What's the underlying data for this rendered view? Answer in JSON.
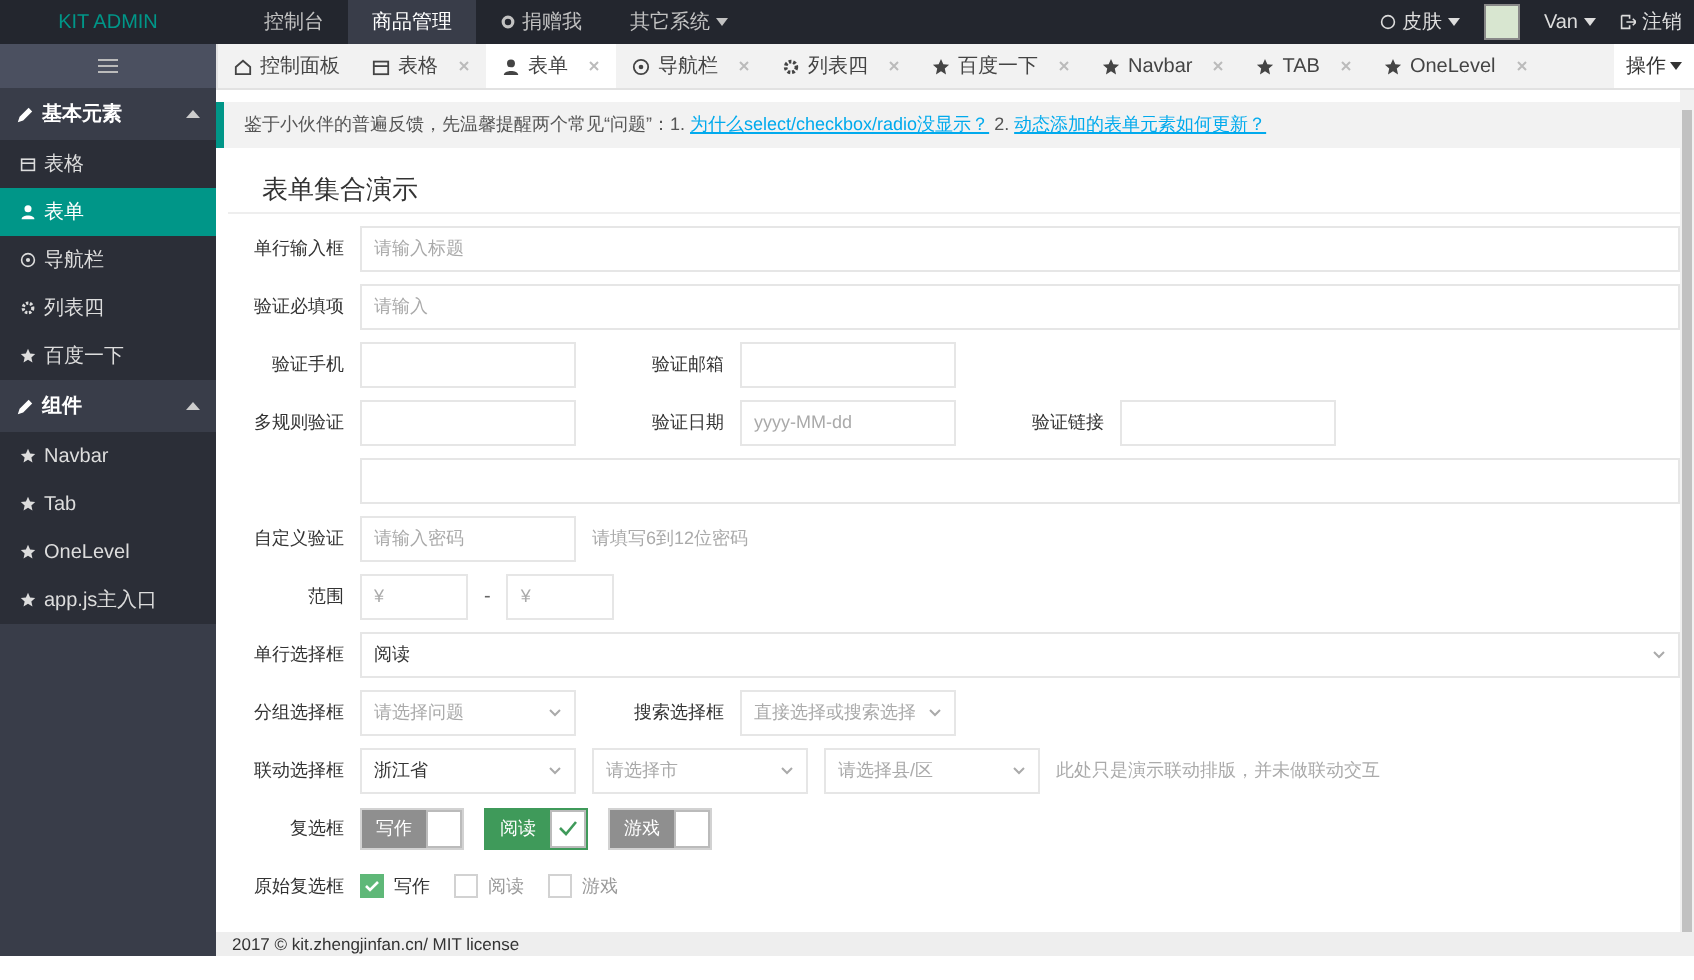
{
  "header": {
    "logo": "KIT ADMIN",
    "nav": [
      {
        "label": "控制台",
        "selected": false,
        "kind": "plain"
      },
      {
        "label": "商品管理",
        "selected": true,
        "kind": "plain"
      },
      {
        "label": "捐赠我",
        "selected": false,
        "kind": "icon"
      },
      {
        "label": "其它系统",
        "selected": false,
        "kind": "dropdown"
      }
    ],
    "skin": "皮肤",
    "user": "Van",
    "logout": "注销"
  },
  "sidebar": {
    "groups": [
      {
        "title": "基本元素",
        "expanded": true,
        "items": [
          {
            "label": "表格",
            "selected": false
          },
          {
            "label": "表单",
            "selected": true
          },
          {
            "label": "导航栏",
            "selected": false
          },
          {
            "label": "列表四",
            "selected": false
          },
          {
            "label": "百度一下",
            "selected": false
          }
        ]
      },
      {
        "title": "组件",
        "expanded": true,
        "items": [
          {
            "label": "Navbar",
            "selected": false
          },
          {
            "label": "Tab",
            "selected": false
          },
          {
            "label": "OneLevel",
            "selected": false
          },
          {
            "label": "app.js主入口",
            "selected": false
          }
        ]
      }
    ]
  },
  "tabs": [
    {
      "label": "控制面板",
      "selected": false,
      "closable": false
    },
    {
      "label": "表格",
      "selected": false,
      "closable": true
    },
    {
      "label": "表单",
      "selected": true,
      "closable": true
    },
    {
      "label": "导航栏",
      "selected": false,
      "closable": true
    },
    {
      "label": "列表四",
      "selected": false,
      "closable": true
    },
    {
      "label": "百度一下",
      "selected": false,
      "closable": true
    },
    {
      "label": "Navbar",
      "selected": false,
      "closable": true
    },
    {
      "label": "TAB",
      "selected": false,
      "closable": true
    },
    {
      "label": "OneLevel",
      "selected": false,
      "closable": true
    }
  ],
  "tab_actions": "操作",
  "notice_parts": [
    {
      "text": "鉴于小伙伴的普遍反馈，先温馨提醒两个常见“问题”：1. ",
      "kind": "text"
    },
    {
      "text": "为什么select/checkbox/radio没显示？",
      "kind": "link"
    },
    {
      "text": " 2. ",
      "kind": "text"
    },
    {
      "text": "动态添加的表单元素如何更新？",
      "kind": "link"
    }
  ],
  "form_title": "表单集合演示",
  "rows": [
    {
      "kind": "block",
      "label": "单行输入框",
      "field": {
        "kind": "input",
        "placeholder": "请输入标题"
      }
    },
    {
      "kind": "block",
      "label": "验证必填项",
      "field": {
        "kind": "input",
        "placeholder": "请输入"
      }
    },
    {
      "kind": "inline",
      "items": [
        {
          "label": "验证手机",
          "field": {
            "kind": "input"
          }
        },
        {
          "label": "验证邮箱",
          "field": {
            "kind": "input"
          }
        }
      ]
    },
    {
      "kind": "inline",
      "items": [
        {
          "label": "多规则验证",
          "field": {
            "kind": "input"
          }
        },
        {
          "label": "验证日期",
          "field": {
            "kind": "input",
            "placeholder": "yyyy-MM-dd"
          }
        },
        {
          "label": "验证链接",
          "field": {
            "kind": "input"
          }
        }
      ]
    },
    {
      "kind": "block",
      "field": {
        "kind": "input"
      }
    },
    {
      "kind": "inline",
      "items": [
        {
          "label": "自定义验证",
          "field": {
            "kind": "input",
            "placeholder": "请输入密码"
          }
        }
      ],
      "hint": "请填写6到12位密码"
    },
    {
      "kind": "multi",
      "label": "范围",
      "separator": "-",
      "fields": [
        {
          "kind": "input",
          "placeholder": "¥"
        },
        {
          "kind": "input",
          "placeholder": "¥"
        }
      ]
    },
    {
      "kind": "block",
      "label": "单行选择框",
      "field": {
        "kind": "select",
        "value": "阅读"
      }
    },
    {
      "kind": "inline",
      "items": [
        {
          "label": "分组选择框",
          "field": {
            "kind": "select",
            "placeholder": "请选择问题"
          }
        },
        {
          "label": "搜索选择框",
          "field": {
            "kind": "select",
            "placeholder": "直接选择或搜索选择"
          }
        }
      ]
    },
    {
      "kind": "multi",
      "label": "联动选择框",
      "fields": [
        {
          "kind": "select",
          "value": "浙江省"
        },
        {
          "kind": "select",
          "placeholder": "请选择市"
        },
        {
          "kind": "select",
          "placeholder": "请选择县/区"
        }
      ],
      "hint": "此处只是演示联动排版，并未做联动交互"
    },
    {
      "kind": "switches",
      "label": "复选框",
      "options": [
        {
          "label": "写作",
          "checked": false
        },
        {
          "label": "阅读",
          "checked": true
        },
        {
          "label": "游戏",
          "checked": false
        }
      ]
    },
    {
      "kind": "checkboxes",
      "label": "原始复选框",
      "options": [
        {
          "label": "写作",
          "checked": true
        },
        {
          "label": "阅读",
          "checked": false
        },
        {
          "label": "游戏",
          "checked": false
        }
      ]
    }
  ],
  "footer": "2017 © kit.zhengjinfan.cn/ MIT license"
}
